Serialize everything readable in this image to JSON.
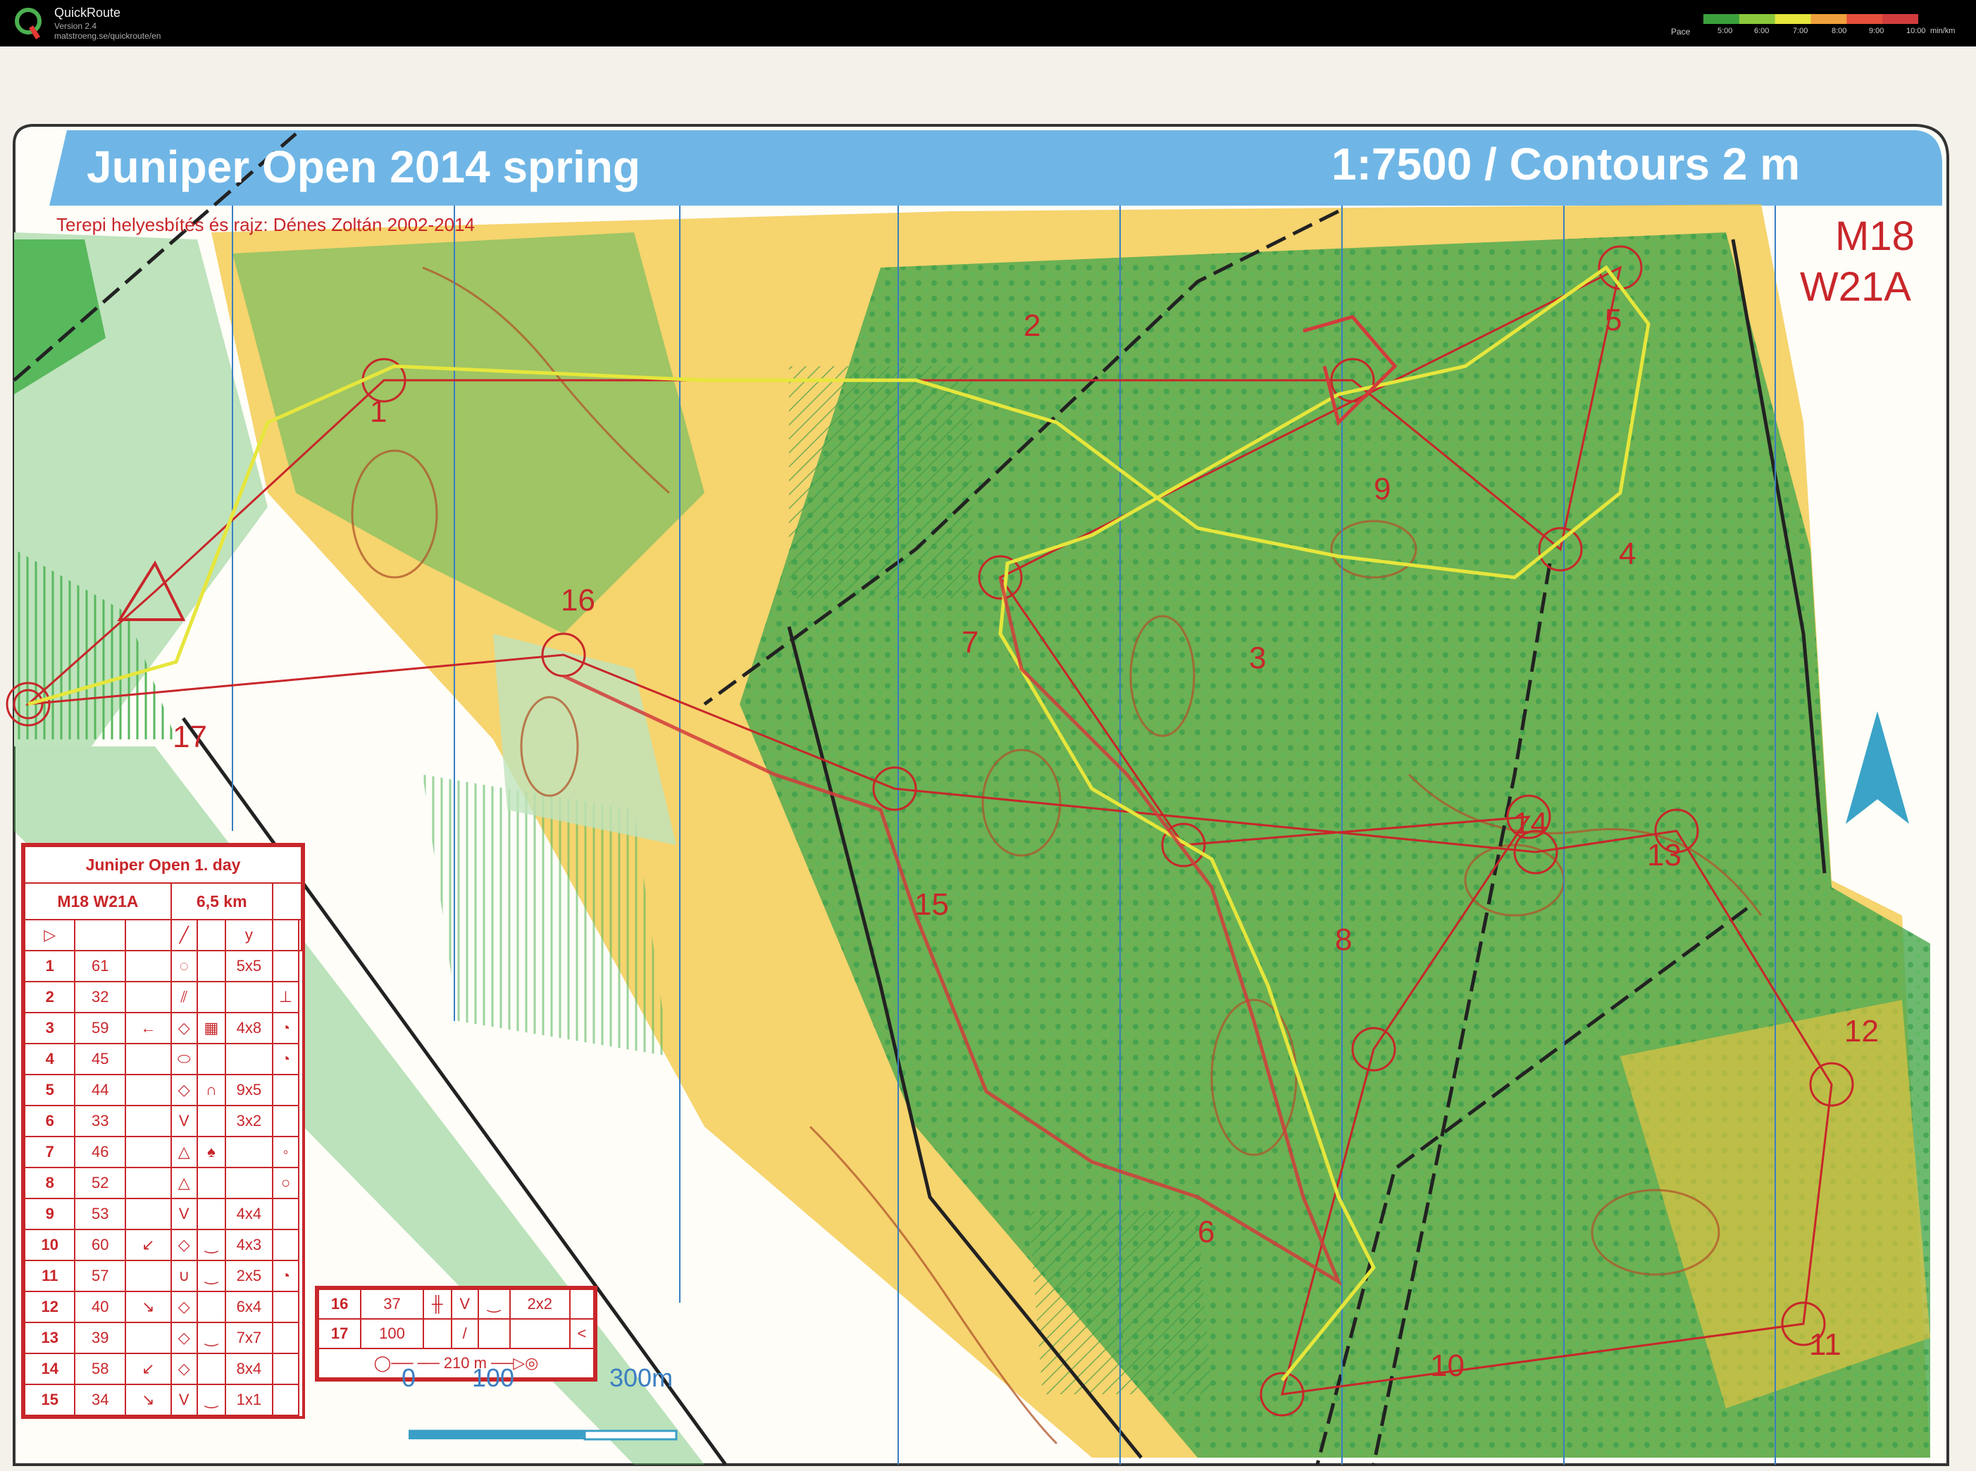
{
  "app": {
    "name": "QuickRoute",
    "version": "Version 2.4",
    "url": "matstroeng.se/quickroute/en",
    "pace_label": "Pace",
    "pace_ticks": [
      "5:00",
      "6:00",
      "7:00",
      "8:00",
      "9:00",
      "10:00"
    ],
    "pace_unit": "min/km",
    "pace_colors": [
      "#3ca03c",
      "#8cc83c",
      "#e6e63c",
      "#f0a03c",
      "#e6503c",
      "#d23c3c"
    ]
  },
  "map": {
    "title": "Juniper Open 2014 spring",
    "scale_text": "1:7500 / Contours 2 m",
    "credit": "Terepi helyesbítés és rajz: Dénes Zoltán 2002-2014",
    "class_line_1": "M18",
    "class_line_2": "W21A",
    "control_numbers": [
      "1",
      "2",
      "3",
      "4",
      "5",
      "6",
      "7",
      "8",
      "9",
      "10",
      "11",
      "12",
      "13",
      "14",
      "15",
      "16",
      "17"
    ],
    "scale_labels": [
      "0",
      "100",
      "300m"
    ],
    "colors": {
      "course": "#c8262a",
      "header": "#6fb6e6",
      "route_slow": "#d23c3c",
      "route_fast": "#e6e63c"
    }
  },
  "description": {
    "title": "Juniper Open 1. day",
    "class": "M18 W21A",
    "length": "6,5 km",
    "rows": [
      {
        "no": "1",
        "code": "61",
        "c": "",
        "d": "◌",
        "e": "",
        "f": "5x5",
        "g": ""
      },
      {
        "no": "2",
        "code": "32",
        "c": "",
        "d": "⫽",
        "e": "",
        "f": "",
        "g": "⊥"
      },
      {
        "no": "3",
        "code": "59",
        "c": "←",
        "d": "◇",
        "e": "▦",
        "f": "4x8",
        "g": "◔"
      },
      {
        "no": "4",
        "code": "45",
        "c": "",
        "d": "⬭",
        "e": "",
        "f": "",
        "g": "◔"
      },
      {
        "no": "5",
        "code": "44",
        "c": "",
        "d": "◇",
        "e": "∩",
        "f": "9x5",
        "g": ""
      },
      {
        "no": "6",
        "code": "33",
        "c": "",
        "d": "V",
        "e": "",
        "f": "3x2",
        "g": ""
      },
      {
        "no": "7",
        "code": "46",
        "c": "",
        "d": "△",
        "e": "♠",
        "f": "",
        "g": "◦"
      },
      {
        "no": "8",
        "code": "52",
        "c": "",
        "d": "△",
        "e": "",
        "f": "",
        "g": "○"
      },
      {
        "no": "9",
        "code": "53",
        "c": "",
        "d": "V",
        "e": "",
        "f": "4x4",
        "g": ""
      },
      {
        "no": "10",
        "code": "60",
        "c": "↙",
        "d": "◇",
        "e": "‿",
        "f": "4x3",
        "g": ""
      },
      {
        "no": "11",
        "code": "57",
        "c": "",
        "d": "∪",
        "e": "‿",
        "f": "2x5",
        "g": "◔"
      },
      {
        "no": "12",
        "code": "40",
        "c": "↘",
        "d": "◇",
        "e": "",
        "f": "6x4",
        "g": ""
      },
      {
        "no": "13",
        "code": "39",
        "c": "",
        "d": "◇",
        "e": "‿",
        "f": "7x7",
        "g": ""
      },
      {
        "no": "14",
        "code": "58",
        "c": "↙",
        "d": "◇",
        "e": "",
        "f": "8x4",
        "g": ""
      },
      {
        "no": "15",
        "code": "34",
        "c": "↘",
        "d": "V",
        "e": "‿",
        "f": "1x1",
        "g": ""
      }
    ],
    "rows2": [
      {
        "no": "16",
        "code": "37",
        "c": "╫",
        "d": "V",
        "e": "‿",
        "f": "2x2",
        "g": ""
      },
      {
        "no": "17",
        "code": "100",
        "c": "",
        "d": "/",
        "e": "",
        "f": "",
        "g": "<"
      }
    ],
    "finish": "210 m"
  }
}
